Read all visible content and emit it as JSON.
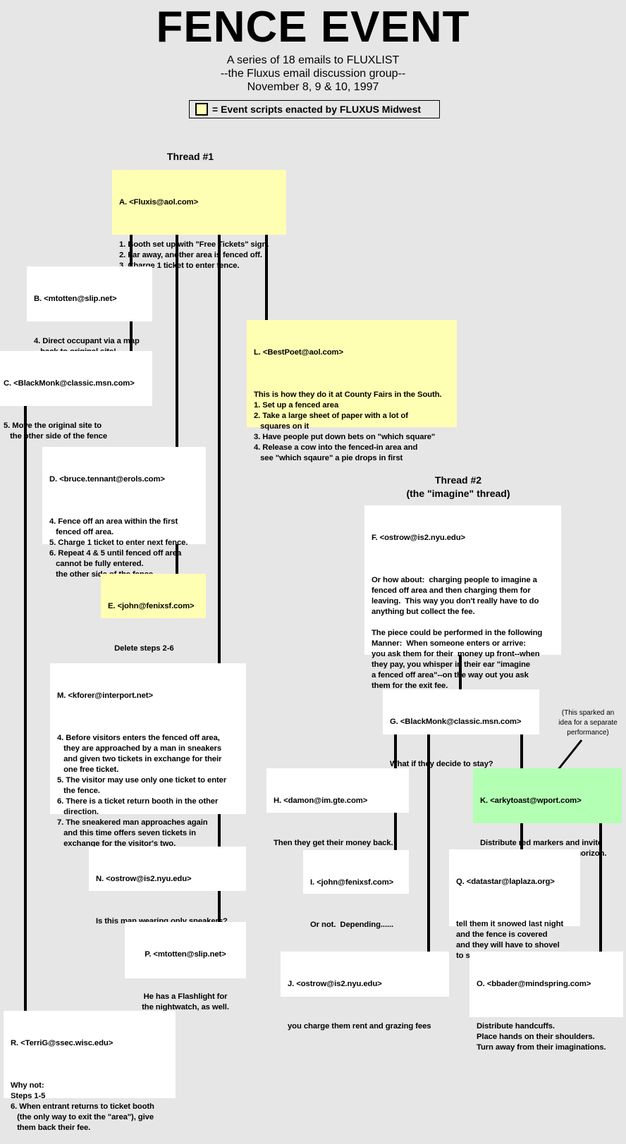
{
  "header": {
    "title": "FENCE EVENT",
    "subtitle_lines": [
      "A series of 18 emails to FLUXLIST",
      "--the Fluxus email discussion group--",
      "November 8, 9 & 10, 1997"
    ],
    "legend": {
      "label": "= Event scripts enacted by FLUXUS Midwest",
      "swatch_color": "#ffffb3"
    }
  },
  "colors": {
    "background": "#e6e6e6",
    "default_box": "#ffffff",
    "enacted_box": "#ffffb3",
    "highlight_box": "#b3ffb3",
    "connector": "#000000"
  },
  "threads": [
    {
      "title": "Thread #1",
      "subtitle": ""
    },
    {
      "title": "Thread #2",
      "subtitle": "(the \"imagine\" thread)"
    }
  ],
  "note": {
    "lines": [
      "(This sparked an",
      "idea for a separate",
      "performance)"
    ]
  },
  "emails": {
    "A": {
      "from": "A. <Fluxis@aol.com>",
      "style": "enacted",
      "body": [
        "1. Booth set up with \"Free Tickets\" sign.",
        "2. Far away, another area is fenced off.",
        "3. Charge 1 ticket to enter fence."
      ]
    },
    "B": {
      "from": "B. <mtotten@slip.net>",
      "style": "default",
      "body": [
        "4. Direct occupant via a map",
        "   back to original site!"
      ]
    },
    "C": {
      "from": "C. <BlackMonk@classic.msn.com>",
      "style": "default",
      "body": [
        "5. Move the original site to",
        "   the other side of the fence"
      ]
    },
    "L": {
      "from": "L. <BestPoet@aol.com>",
      "style": "enacted",
      "body": [
        "This is how they do it at County Fairs in the South.",
        "1. Set up a fenced area",
        "2. Take a large sheet of paper with a lot of",
        "   squares on it",
        "3. Have people put down bets on \"which square\"",
        "4. Release a cow into the fenced-in area and",
        "   see \"which sqaure\" a pie drops in first"
      ]
    },
    "D": {
      "from": "D. <bruce.tennant@erols.com>",
      "style": "default",
      "body": [
        "4. Fence off an area within the first",
        "   fenced off area.",
        "5. Charge 1 ticket to enter next fence.",
        "6. Repeat 4 & 5 until fenced off area",
        "   cannot be fully entered.",
        "   the other side of the fence"
      ]
    },
    "E": {
      "from": "E. <john@fenixsf.com>",
      "style": "enacted",
      "body": [
        "   Delete steps 2-6"
      ]
    },
    "F": {
      "from": "F. <ostrow@is2.nyu.edu>",
      "style": "default",
      "body": [
        "Or how about:  charging people to imagine a",
        "fenced off area and then charging them for",
        "leaving.  This way you don't really have to do",
        "anything but collect the fee.",
        "",
        "The piece could be performed in the following",
        "Manner:  When someone enters or arrive:",
        "you ask them for their  money up front--when",
        "they pay, you whisper in their ear \"imagine",
        "a fenced off area\"--on the way out you ask",
        "them for the exit fee."
      ]
    },
    "M": {
      "from": "M. <kforer@interport.net>",
      "style": "default",
      "body": [
        "4. Before visitors enters the fenced off area,",
        "   they are approached by a man in sneakers",
        "   and given two tickets in exchange for their",
        "   one free ticket.",
        "5. The visitor may use only one ticket to enter",
        "   the fence.",
        "6. There is a ticket return booth in the other",
        "   direction.",
        "7. The sneakered man approaches again",
        "   and this time offers seven tickets in",
        "   exchange for the visitor's two."
      ]
    },
    "G": {
      "from": "G. <BlackMonk@classic.msn.com>",
      "style": "default",
      "body": [
        "What if they decide to stay?"
      ]
    },
    "H": {
      "from": "H. <damon@im.gte.com>",
      "style": "default",
      "body": [
        "Then they get their money back."
      ]
    },
    "K": {
      "from": "K. <arkytoast@wport.com>",
      "style": "highlight",
      "body": [
        "Distribute red markers and invite",
        "them to imagine an event horizon."
      ]
    },
    "N": {
      "from": "N. <ostrow@is2.nyu.edu>",
      "style": "default",
      "body": [
        "Is this man wearing only sneakers?"
      ]
    },
    "I": {
      "from": "I. <john@fenixsf.com>",
      "style": "default",
      "body": [
        "Or not.  Depending......"
      ]
    },
    "Q": {
      "from": "Q. <datastar@laplaza.org>",
      "style": "default",
      "body": [
        "tell them it snowed last night",
        "and the fence is covered",
        "and they will have to shovel",
        "to see it."
      ]
    },
    "P": {
      "from": "P. <mtotten@slip.net>",
      "style": "default",
      "body": [
        "He has a Flashlight for",
        "the nightwatch, as well."
      ]
    },
    "J": {
      "from": "J. <ostrow@is2.nyu.edu>",
      "style": "default",
      "body": [
        "you charge them rent and grazing fees"
      ]
    },
    "O": {
      "from": "O. <bbader@mindspring.com>",
      "style": "default",
      "body": [
        "Distribute handcuffs.",
        "Place hands on their shoulders.",
        "Turn away from their imaginations."
      ]
    },
    "R": {
      "from": "R. <TerriG@ssec.wisc.edu>",
      "style": "default",
      "body": [
        "Why not:",
        "Steps 1-5",
        "6. When entrant returns to ticket booth",
        "   (the only way to exit the \"area\"), give",
        "   them back their fee."
      ]
    }
  },
  "replies": [
    [
      "A",
      "B"
    ],
    [
      "B",
      "C"
    ],
    [
      "A",
      "D"
    ],
    [
      "A",
      "M"
    ],
    [
      "A",
      "L"
    ],
    [
      "D",
      "E"
    ],
    [
      "C",
      "R"
    ],
    [
      "M",
      "N"
    ],
    [
      "N",
      "P"
    ],
    [
      "F",
      "G"
    ],
    [
      "G",
      "H"
    ],
    [
      "G",
      "J"
    ],
    [
      "G",
      "K"
    ],
    [
      "H",
      "I"
    ],
    [
      "K",
      "Q"
    ],
    [
      "K",
      "O"
    ]
  ]
}
